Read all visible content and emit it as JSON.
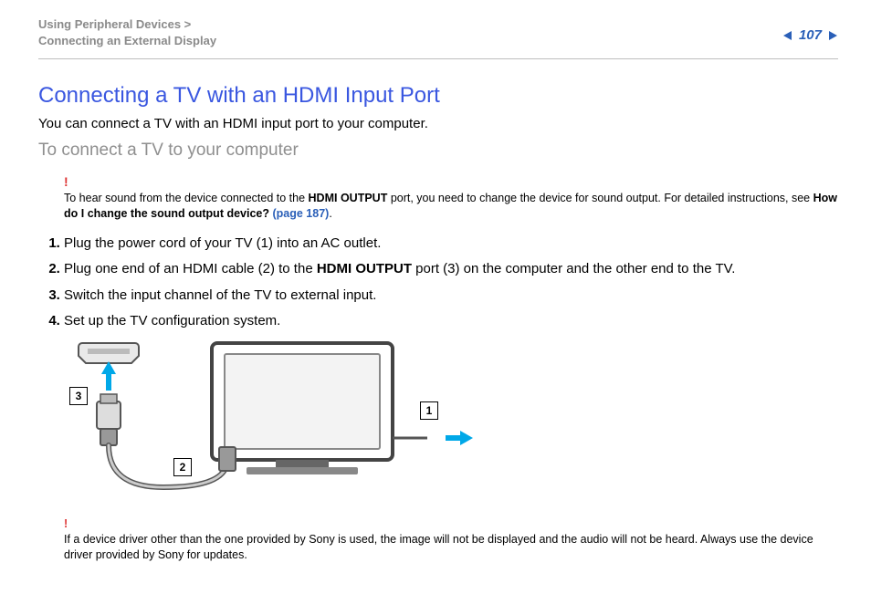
{
  "header": {
    "breadcrumb_line1": "Using Peripheral Devices >",
    "breadcrumb_line2": "Connecting an External Display",
    "page_number": "107"
  },
  "title": "Connecting a TV with an HDMI Input Port",
  "intro": "You can connect a TV with an HDMI input port to your computer.",
  "subhead": "To connect a TV to your computer",
  "note1": {
    "bang": "!",
    "text_a": "To hear sound from the device connected to the ",
    "bold_a": "HDMI OUTPUT",
    "text_b": " port, you need to change the device for sound output. For detailed instructions, see ",
    "bold_b": "How do I change the sound output device? ",
    "link": "(page 187)",
    "text_c": "."
  },
  "steps": {
    "s1": "Plug the power cord of your TV (1) into an AC outlet.",
    "s2a": "Plug one end of an HDMI cable (2) to the ",
    "s2bold": "HDMI OUTPUT",
    "s2b": " port (3) on the computer and the other end to the TV.",
    "s3": "Switch the input channel of the TV to external input.",
    "s4": "Set up the TV configuration system."
  },
  "callouts": {
    "c1": "1",
    "c2": "2",
    "c3": "3"
  },
  "note2": {
    "bang": "!",
    "text": "If a device driver other than the one provided by Sony is used, the image will not be displayed and the audio will not be heard. Always use the device driver provided by Sony for updates."
  }
}
